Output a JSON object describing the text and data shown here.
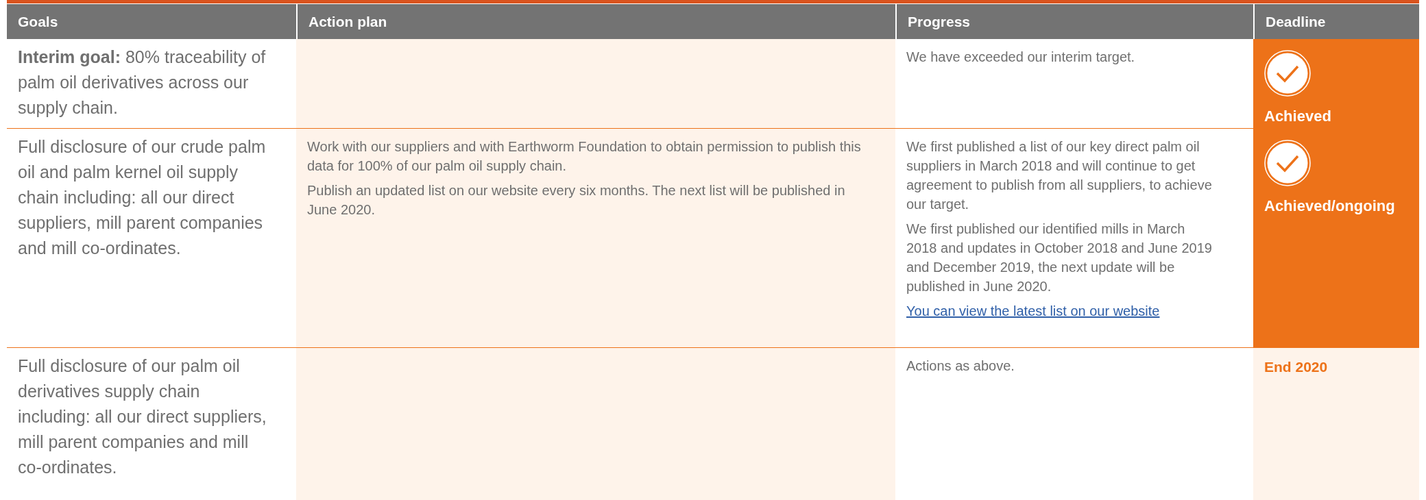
{
  "table": {
    "columns": [
      "Goals",
      "Action plan",
      "Progress",
      "Deadline"
    ],
    "rows": [
      {
        "goal": "**Interim goal:** 80% traceability of palm oil derivatives across our supply chain.",
        "action_plan": [],
        "progress": [
          {
            "kind": "text",
            "text": "We have exceeded our interim target."
          }
        ],
        "deadline": {
          "kind": "achieved",
          "text": "Achieved"
        }
      },
      {
        "goal": "Full disclosure of our crude palm oil and palm kernel oil supply chain including: all our direct suppliers, mill parent companies and mill co-ordinates.",
        "action_plan": [
          "Work with our suppliers and with Earthworm Foundation to obtain permission to publish this data for 100% of our palm oil supply chain.",
          "Publish an updated list on our website every six months. The next list will be published in June 2020."
        ],
        "progress": [
          {
            "kind": "text",
            "text": "We first published a list of our key direct palm oil suppliers in March 2018 and will continue to get agreement to publish from all suppliers, to achieve our target."
          },
          {
            "kind": "text",
            "text": "We first published our identified mills in March 2018 and updates in October 2018 and June 2019 and December 2019, the next update will be published in June 2020."
          },
          {
            "kind": "link",
            "text": "You can view the latest list on our website"
          }
        ],
        "deadline": {
          "kind": "achieved",
          "text": "Achieved/ongoing"
        }
      },
      {
        "goal": "Full disclosure of our palm oil derivatives supply chain including: all our direct suppliers, mill parent companies and mill co-ordinates.",
        "action_plan": [],
        "progress": [
          {
            "kind": "text",
            "text": "Actions as above."
          }
        ],
        "deadline": {
          "kind": "date",
          "text": "End 2020"
        }
      }
    ]
  }
}
